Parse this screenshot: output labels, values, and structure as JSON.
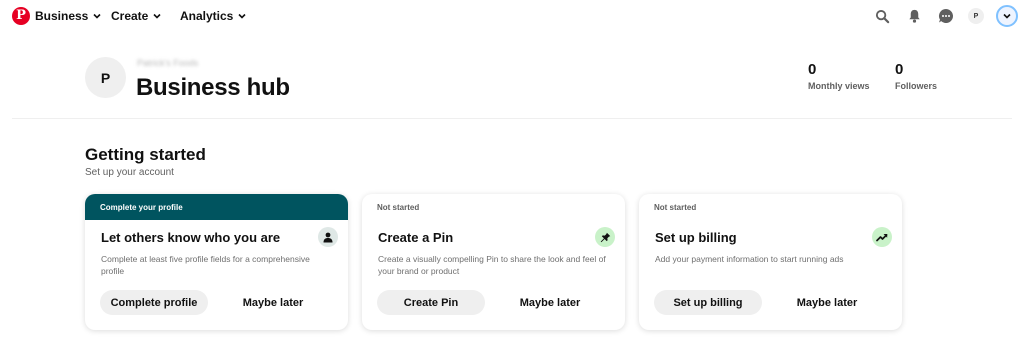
{
  "nav": {
    "logo_glyph": "P",
    "items": [
      {
        "label": "Business"
      },
      {
        "label": "Create"
      },
      {
        "label": "Analytics"
      }
    ],
    "icons": [
      "search-icon",
      "bell-icon",
      "messages-icon"
    ],
    "user_avatar_initial": "P"
  },
  "header": {
    "account_name": "Patrick's Foods",
    "avatar_initial": "P",
    "title": "Business hub",
    "stats": [
      {
        "value": "0",
        "label": "Monthly views"
      },
      {
        "value": "0",
        "label": "Followers"
      }
    ]
  },
  "section": {
    "title": "Getting started",
    "subtitle": "Set up your account"
  },
  "cards": [
    {
      "status": "Complete your profile",
      "title": "Let others know who you are",
      "icon": "person-icon",
      "icon_bg": "#dfe8e6",
      "description": "Complete at least five profile fields for a comprehensive profile",
      "primary_label": "Complete profile",
      "secondary_label": "Maybe later"
    },
    {
      "status": "Not started",
      "title": "Create a Pin",
      "icon": "pin-icon",
      "icon_bg": "#c9f2c9",
      "description": "Create a visually compelling Pin to share the look and feel of your brand or product",
      "primary_label": "Create Pin",
      "secondary_label": "Maybe later"
    },
    {
      "status": "Not started",
      "title": "Set up billing",
      "icon": "trending-up-icon",
      "icon_bg": "#c9f2c9",
      "description": "Add your payment information to start running ads",
      "primary_label": "Set up billing",
      "secondary_label": "Maybe later"
    }
  ],
  "colors": {
    "brand": "#e60023",
    "status_active_bg": "#00545f",
    "button_bg": "#efefef"
  }
}
